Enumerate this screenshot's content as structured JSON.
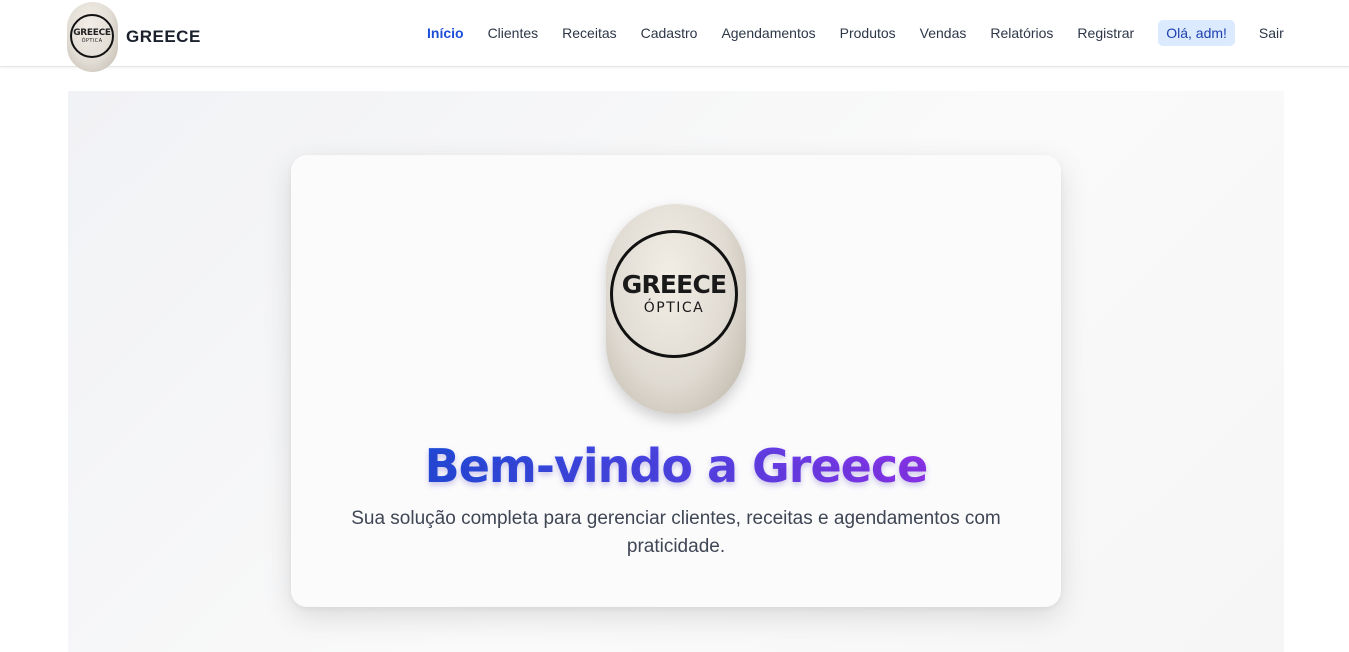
{
  "brand": {
    "logo_line1": "GREECE",
    "logo_line2": "ÓPTICA",
    "name": "GREECE"
  },
  "nav": {
    "items": [
      {
        "label": "Início",
        "active": true
      },
      {
        "label": "Clientes"
      },
      {
        "label": "Receitas"
      },
      {
        "label": "Cadastro"
      },
      {
        "label": "Agendamentos"
      },
      {
        "label": "Produtos"
      },
      {
        "label": "Vendas"
      },
      {
        "label": "Relatórios"
      },
      {
        "label": "Registrar"
      }
    ],
    "greeting": "Olá, adm!",
    "logout": "Sair"
  },
  "hero": {
    "title": "Bem-vindo a Greece",
    "subtitle": "Sua solução completa para gerenciar clientes, receitas e agendamentos com praticidade."
  },
  "colors": {
    "accent": "#1d4ed8",
    "gradient_end": "#9333ea",
    "greeting_bg": "#dbeafe"
  }
}
